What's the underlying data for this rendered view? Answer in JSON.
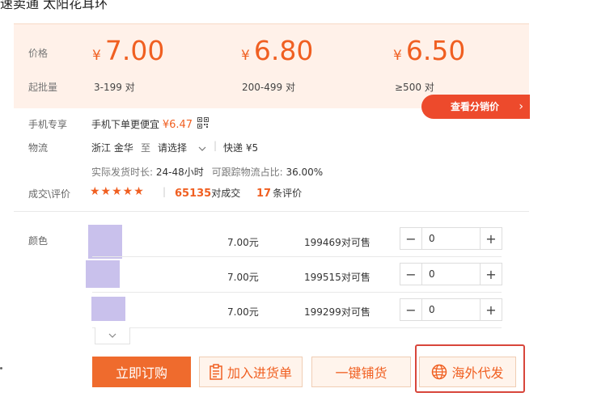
{
  "product_title": "速卖通 太阳花耳环",
  "price": {
    "label": "价格",
    "moq_label": "起批量",
    "currency": "¥",
    "tiers": [
      {
        "price": "7.00",
        "qty": "3-199 对"
      },
      {
        "price": "6.80",
        "qty": "200-499 对"
      },
      {
        "price": "6.50",
        "qty": "≥500 对"
      }
    ],
    "distribution_button": "查看分销价",
    "distribution_chevron": "›"
  },
  "mobile": {
    "label": "手机专享",
    "text": "手机下单更便宜",
    "price": "¥6.47"
  },
  "logistics": {
    "label": "物流",
    "origin": "浙江 金华",
    "to": "至",
    "select": "请选择",
    "separator": "|",
    "express": "快递 ¥5",
    "ship_time_label": "实际发货时长:",
    "ship_time": "24-48小时",
    "trackable_label": "可跟踪物流占比:",
    "trackable": "36.00%"
  },
  "reviews": {
    "label": "成交\\评价",
    "stars": "★★★★★",
    "rating": 5,
    "separator": "|",
    "deals_count": "65135",
    "deals_suffix": "对成交",
    "review_count": "17",
    "review_suffix": "条评价"
  },
  "variants": {
    "label": "颜色",
    "rows": [
      {
        "price": "7.00元",
        "stock": "199469",
        "stock_suffix": "对可售",
        "qty": "0"
      },
      {
        "price": "7.00元",
        "stock": "199515",
        "stock_suffix": "对可售",
        "qty": "0"
      },
      {
        "price": "7.00元",
        "stock": "199299",
        "stock_suffix": "对可售",
        "qty": "0"
      }
    ],
    "minus": "−",
    "plus": "+"
  },
  "actions": {
    "buy_now": "立即订购",
    "add_to_cart": "加入进货单",
    "one_click": "一键铺货",
    "overseas": "海外代发"
  },
  "colors": {
    "accent": "#f05f21",
    "button_red": "#ed4a2c",
    "panel_bg": "#fff1e9",
    "highlight_border": "#d8463b"
  }
}
